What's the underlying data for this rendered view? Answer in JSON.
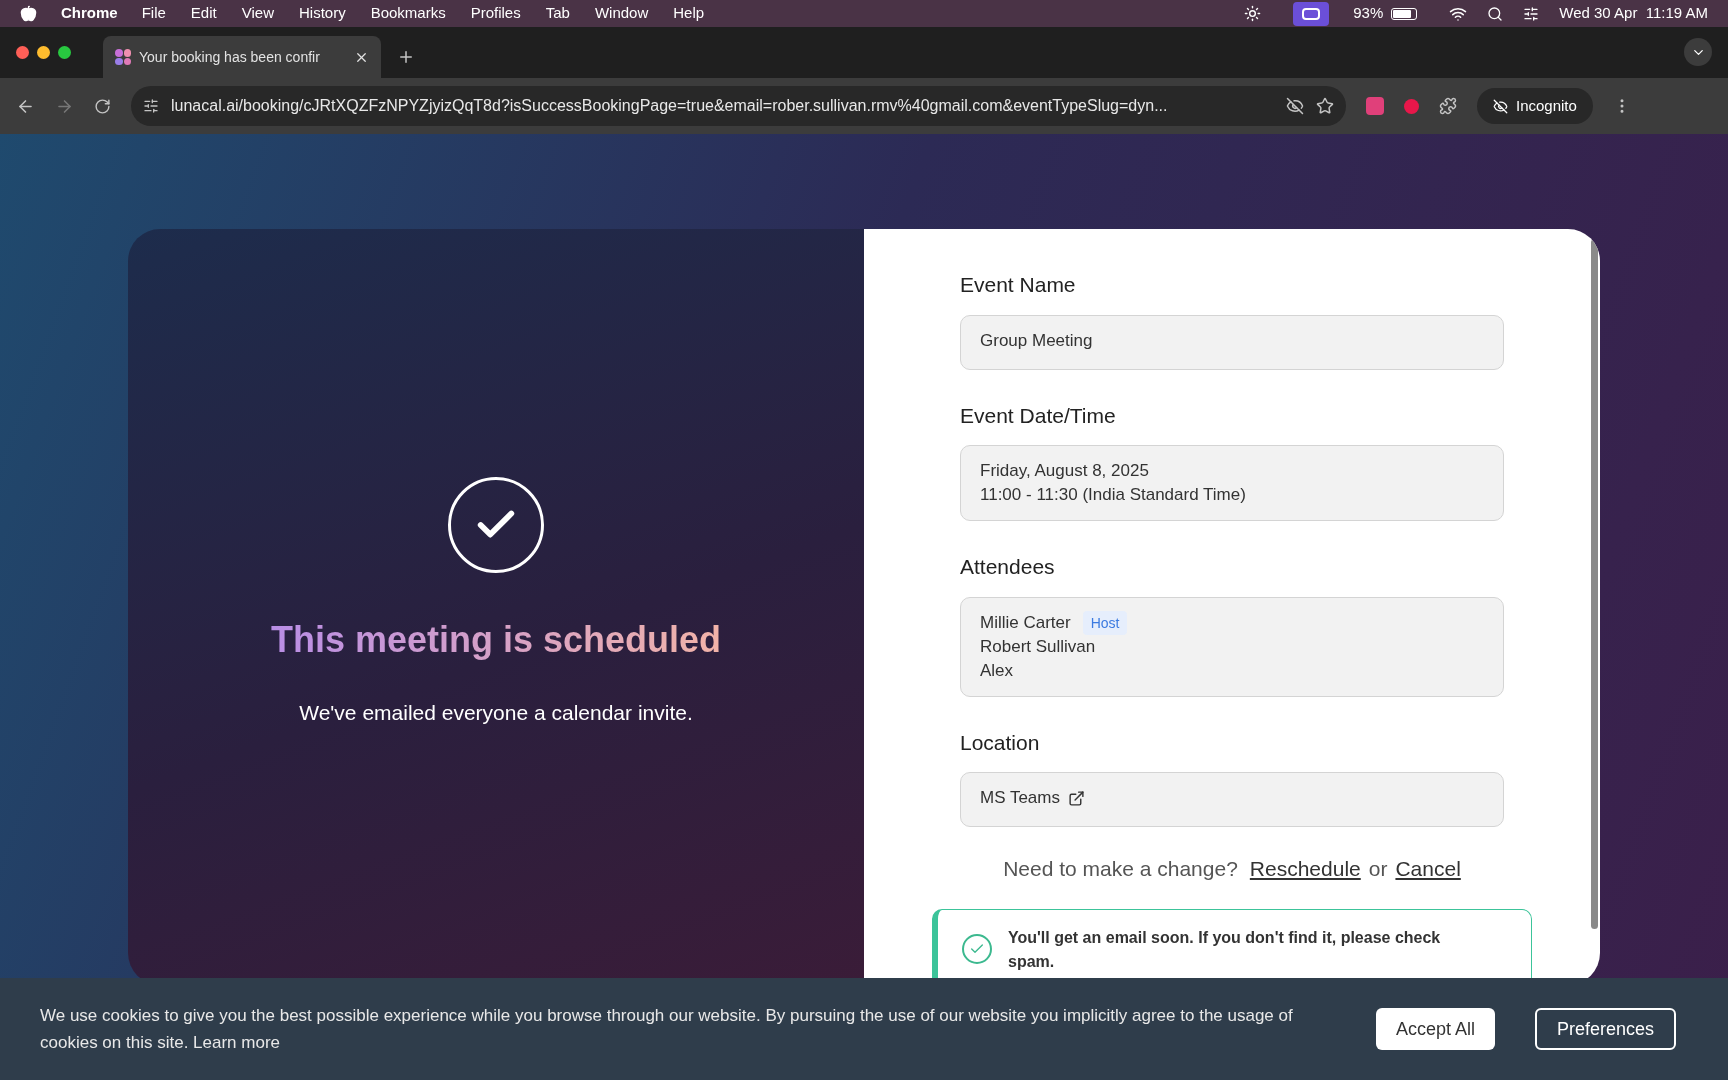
{
  "menu_bar": {
    "app": "Chrome",
    "items": [
      "File",
      "Edit",
      "View",
      "History",
      "Bookmarks",
      "Profiles",
      "Tab",
      "Window",
      "Help"
    ],
    "battery": "93%",
    "clock": "Wed 30 Apr  11:19 AM"
  },
  "browser": {
    "tab_title": "Your booking has been confir",
    "url": "lunacal.ai/booking/cJRtXQZFzNPYZjyizQqT8d?isSuccessBookingPage=true&email=rober.sullivan.rmv%40gmail.com&eventTypeSlug=dyn...",
    "profile": "Incognito"
  },
  "confirmation": {
    "title": "This meeting is scheduled",
    "subtitle": "We've emailed everyone a calendar invite."
  },
  "details": [
    {
      "kind": "text",
      "label": "Event Name",
      "lines": [
        "Group Meeting"
      ]
    },
    {
      "kind": "text",
      "label": "Event Date/Time",
      "lines": [
        "Friday, August 8, 2025",
        "11:00 - 11:30 (India Standard Time)"
      ]
    },
    {
      "kind": "attendees",
      "label": "Attendees",
      "attendees": [
        {
          "name": "Millie Carter",
          "badge": "Host"
        },
        {
          "name": "Robert Sullivan"
        },
        {
          "name": "Alex"
        }
      ]
    },
    {
      "kind": "link",
      "label": "Location",
      "lines": [
        "MS Teams"
      ]
    }
  ],
  "change": {
    "prompt": "Need to make a change?",
    "reschedule": "Reschedule",
    "or": "or",
    "cancel": "Cancel"
  },
  "notice": "You'll get an email soon. If you don't find it, please check spam.",
  "cookie_bar": {
    "text": "We use cookies to give you the best possible experience while you browse through our website. By pursuing the use of our website you implicitly agree to the usage of cookies on this site.",
    "learn_more": "Learn more",
    "buttons": [
      "Accept All",
      "Preferences"
    ]
  }
}
